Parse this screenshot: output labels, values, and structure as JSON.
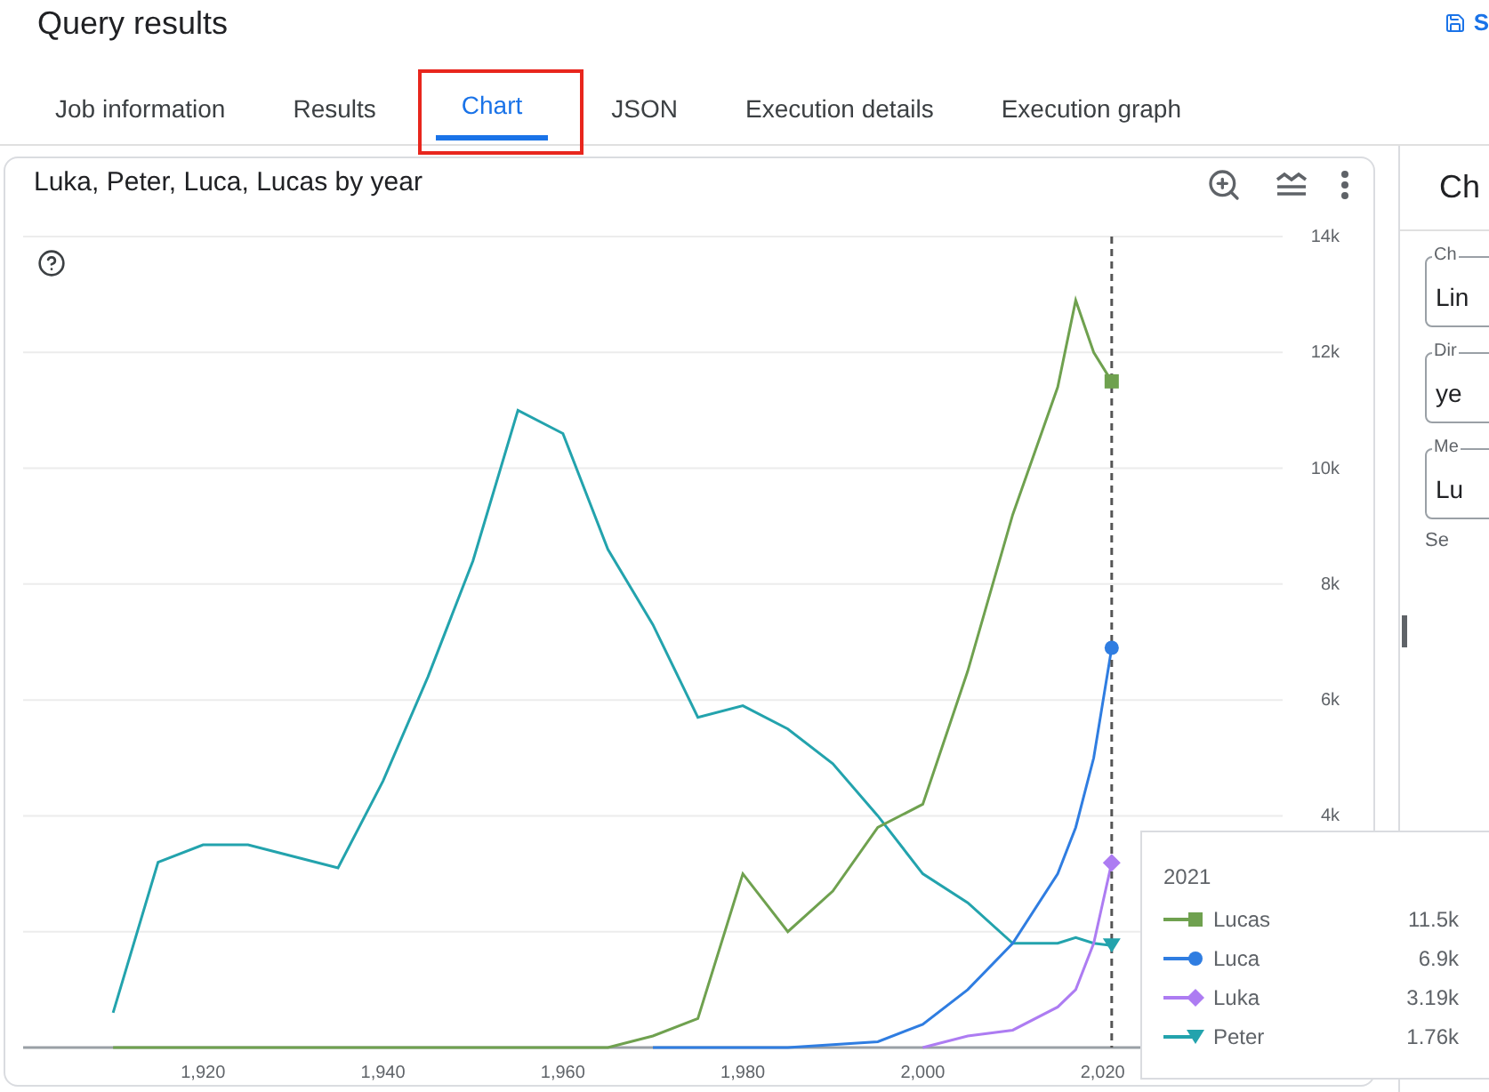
{
  "header": {
    "title": "Query results",
    "action": "S"
  },
  "tabs": [
    {
      "label": "Job information",
      "selected": false,
      "highlighted": false
    },
    {
      "label": "Results",
      "selected": false,
      "highlighted": false
    },
    {
      "label": "Chart",
      "selected": true,
      "highlighted": true
    },
    {
      "label": "JSON",
      "selected": false,
      "highlighted": false
    },
    {
      "label": "Execution details",
      "selected": false,
      "highlighted": false
    },
    {
      "label": "Execution graph",
      "selected": false,
      "highlighted": false
    }
  ],
  "chart_card": {
    "title": "Luka, Peter, Luca, Lucas by year",
    "chart_data": {
      "type": "line",
      "grid": true,
      "x": [
        1910,
        1915,
        1920,
        1925,
        1930,
        1935,
        1940,
        1945,
        1950,
        1955,
        1960,
        1965,
        1970,
        1975,
        1980,
        1985,
        1990,
        1995,
        2000,
        2005,
        2010,
        2015,
        2017,
        2019,
        2021
      ],
      "series": [
        {
          "name": "Lucas",
          "color": "#6fa14f",
          "values": [
            0,
            0,
            0,
            0,
            0,
            0,
            0,
            0,
            0,
            0,
            0,
            0,
            200,
            500,
            3000,
            2000,
            2700,
            3800,
            4200,
            6500,
            9200,
            11400,
            12900,
            12000,
            11500
          ]
        },
        {
          "name": "Luca",
          "color": "#2f7de1",
          "values": [
            null,
            null,
            null,
            null,
            null,
            null,
            null,
            null,
            null,
            null,
            null,
            null,
            0,
            0,
            0,
            0,
            50,
            100,
            400,
            1000,
            1800,
            3000,
            3800,
            5000,
            6900
          ]
        },
        {
          "name": "Luka",
          "color": "#ad7cf2",
          "values": [
            null,
            null,
            null,
            null,
            null,
            null,
            null,
            null,
            null,
            null,
            null,
            null,
            null,
            null,
            null,
            null,
            null,
            null,
            0,
            200,
            300,
            700,
            1000,
            1800,
            3190
          ]
        },
        {
          "name": "Peter",
          "color": "#23a3ad",
          "values": [
            600,
            3200,
            3500,
            3500,
            3300,
            3100,
            4600,
            6400,
            8400,
            11000,
            10600,
            8600,
            7300,
            5700,
            5900,
            5500,
            4900,
            4000,
            3000,
            2500,
            1800,
            1800,
            1900,
            1800,
            1760
          ]
        }
      ],
      "xlim": [
        1900,
        2040
      ],
      "ylim": [
        0,
        14000
      ],
      "xticks": [
        {
          "value": 1920,
          "label": "1,920"
        },
        {
          "value": 1940,
          "label": "1,940"
        },
        {
          "value": 1960,
          "label": "1,960"
        },
        {
          "value": 1980,
          "label": "1,980"
        },
        {
          "value": 2000,
          "label": "2,000"
        },
        {
          "value": 2020,
          "label": "2,020"
        }
      ],
      "yticks": [
        {
          "value": 4000,
          "label": "4k"
        },
        {
          "value": 6000,
          "label": "6k"
        },
        {
          "value": 8000,
          "label": "8k"
        },
        {
          "value": 10000,
          "label": "10k"
        },
        {
          "value": 12000,
          "label": "12k"
        },
        {
          "value": 14000,
          "label": "14k"
        }
      ],
      "ref_lines": [
        {
          "axis": "x",
          "value": 2021
        }
      ]
    },
    "tooltip": {
      "title": "2021",
      "rows": [
        {
          "kind": "square",
          "value": "11.5k"
        },
        {
          "kind": "circle",
          "value": "6.9k"
        },
        {
          "kind": "diamond",
          "value": "3.19k"
        },
        {
          "kind": "triangle",
          "value": "1.76k"
        }
      ]
    }
  },
  "side_panel": {
    "title": "Ch",
    "fields": [
      {
        "label": "Ch",
        "value": "Lin"
      },
      {
        "label": "Dir",
        "value": "ye"
      },
      {
        "label": "Me",
        "value": "Lu"
      }
    ],
    "note": "Se"
  }
}
